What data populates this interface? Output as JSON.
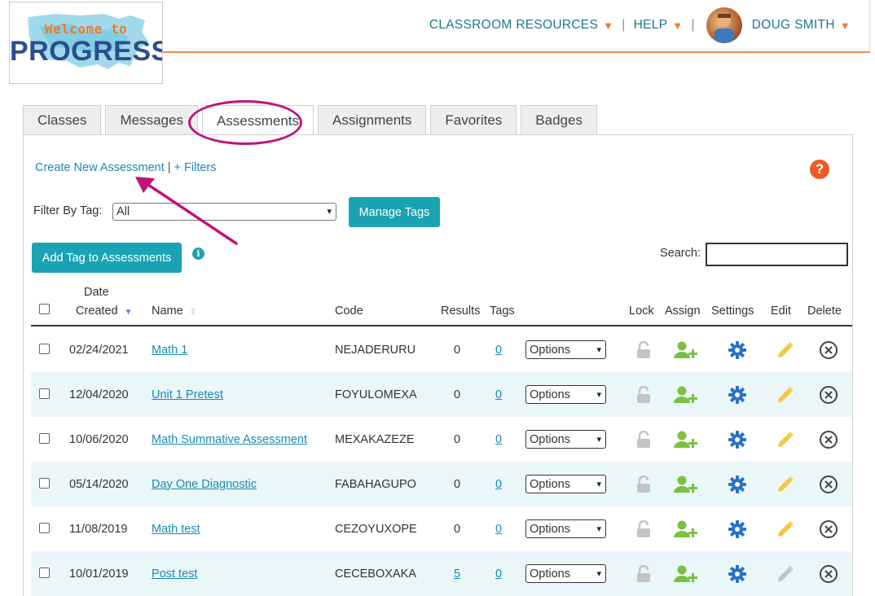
{
  "logo": {
    "welcome": "Welcome to",
    "brand": "PROGRESS"
  },
  "topnav": {
    "classroom_resources": "CLASSROOM RESOURCES",
    "help": "HELP",
    "user": "DOUG SMITH",
    "separator": "|"
  },
  "tabs": [
    {
      "label": "Classes"
    },
    {
      "label": "Messages"
    },
    {
      "label": "Assessments",
      "active": true
    },
    {
      "label": "Assignments"
    },
    {
      "label": "Favorites"
    },
    {
      "label": "Badges"
    }
  ],
  "toolbar": {
    "create_link": "Create New Assessment",
    "separator": "|",
    "filters_link": "+ Filters",
    "help_icon": "?",
    "filter_label": "Filter By Tag:",
    "filter_value": "All",
    "manage_tags": "Manage Tags",
    "add_tag": "Add Tag to Assessments",
    "info_icon": "i",
    "search_label": "Search:"
  },
  "table": {
    "headers": {
      "date_line1": "Date",
      "date_line2": "Created",
      "name": "Name",
      "code": "Code",
      "results": "Results",
      "tags": "Tags",
      "lock": "Lock",
      "assign": "Assign",
      "settings": "Settings",
      "edit": "Edit",
      "delete": "Delete"
    },
    "rows": [
      {
        "date": "02/24/2021",
        "name": "Math 1",
        "code": "NEJADERURU",
        "results": "0",
        "tags": "0",
        "options": "Options",
        "results_link": false,
        "edit_enabled": true
      },
      {
        "date": "12/04/2020",
        "name": "Unit 1 Pretest",
        "code": "FOYULOMEXA",
        "results": "0",
        "tags": "0",
        "options": "Options",
        "results_link": false,
        "edit_enabled": true
      },
      {
        "date": "10/06/2020",
        "name": "Math Summative Assessment",
        "code": "MEXAKAZEZE",
        "results": "0",
        "tags": "0",
        "options": "Options",
        "results_link": false,
        "edit_enabled": true
      },
      {
        "date": "05/14/2020",
        "name": "Day One Diagnostic",
        "code": "FABAHAGUPO",
        "results": "0",
        "tags": "0",
        "options": "Options",
        "results_link": false,
        "edit_enabled": true
      },
      {
        "date": "11/08/2019",
        "name": "Math test",
        "code": "CEZOYUXOPE",
        "results": "0",
        "tags": "0",
        "options": "Options",
        "results_link": false,
        "edit_enabled": true
      },
      {
        "date": "10/01/2019",
        "name": "Post test",
        "code": "CECEBOXAKA",
        "results": "5",
        "tags": "0",
        "options": "Options",
        "results_link": true,
        "edit_enabled": false
      }
    ]
  },
  "colors": {
    "accent_teal": "#1aa3b3",
    "link_blue": "#1a8ab0",
    "orange": "#f07a2c",
    "annotation_magenta": "#c0127a",
    "assign_green": "#7ac142",
    "settings_blue": "#2a72c4",
    "edit_yellow": "#f5c842"
  }
}
